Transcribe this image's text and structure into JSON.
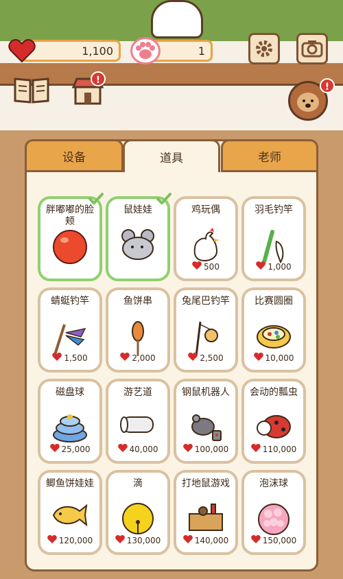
{
  "hud": {
    "hearts": "1,100",
    "paws": "1"
  },
  "tabs": [
    {
      "label": "设备"
    },
    {
      "label": "道具"
    },
    {
      "label": "老师"
    }
  ],
  "items": [
    {
      "name": "胖嘟嘟的脸颊",
      "price": "",
      "owned": true,
      "icon": "red-ball-icon"
    },
    {
      "name": "鼠娃娃",
      "price": "",
      "owned": true,
      "icon": "mouse-doll-icon"
    },
    {
      "name": "鸡玩偶",
      "price": "500",
      "owned": false,
      "icon": "chicken-toy-icon"
    },
    {
      "name": "羽毛钓竿",
      "price": "1,000",
      "owned": false,
      "icon": "feather-rod-icon"
    },
    {
      "name": "蜻蜓钓竿",
      "price": "1,500",
      "owned": false,
      "icon": "dragonfly-rod-icon"
    },
    {
      "name": "鱼饼串",
      "price": "2,000",
      "owned": false,
      "icon": "fishcake-skewer-icon"
    },
    {
      "name": "兔尾巴钓竿",
      "price": "2,500",
      "owned": false,
      "icon": "bunny-tail-rod-icon"
    },
    {
      "name": "比赛圆圈",
      "price": "10,000",
      "owned": false,
      "icon": "race-ring-icon"
    },
    {
      "name": "磁盘球",
      "price": "25,000",
      "owned": false,
      "icon": "disc-ball-icon"
    },
    {
      "name": "游艺道",
      "price": "40,000",
      "owned": false,
      "icon": "play-tunnel-icon"
    },
    {
      "name": "钢鼠机器人",
      "price": "100,000",
      "owned": false,
      "icon": "robot-mouse-icon"
    },
    {
      "name": "会动的瓢虫",
      "price": "110,000",
      "owned": false,
      "icon": "ladybug-icon"
    },
    {
      "name": "鲫鱼饼娃娃",
      "price": "120,000",
      "owned": false,
      "icon": "fish-cake-doll-icon"
    },
    {
      "name": "滴",
      "price": "130,000",
      "owned": false,
      "icon": "bell-ball-icon"
    },
    {
      "name": "打地鼠游戏",
      "price": "140,000",
      "owned": false,
      "icon": "whack-a-mole-icon"
    },
    {
      "name": "泡沫球",
      "price": "150,000",
      "owned": false,
      "icon": "foam-ball-icon"
    }
  ],
  "colors": {
    "accent": "#e9a54a",
    "heart": "#d62b2b",
    "owned_border": "#8fd06f",
    "item_border": "#d9c1a2"
  }
}
